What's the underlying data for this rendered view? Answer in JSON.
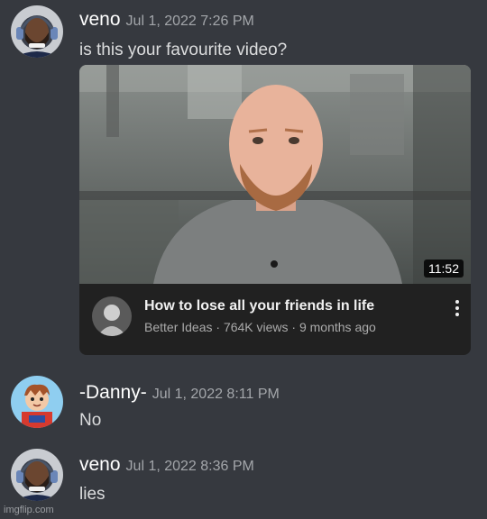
{
  "messages": [
    {
      "author": "veno",
      "timestamp": "Jul 1, 2022 7:26 PM",
      "text": "is this your favourite video?",
      "avatar_icon": "bearded-man-headphones-avatar"
    },
    {
      "author": "-Danny-",
      "timestamp": "Jul 1, 2022 8:11 PM",
      "text": "No",
      "avatar_icon": "cartoon-boy-avatar"
    },
    {
      "author": "veno",
      "timestamp": "Jul 1, 2022 8:36 PM",
      "text": "lies",
      "avatar_icon": "bearded-man-headphones-avatar"
    }
  ],
  "embed": {
    "title": "How to lose all your friends in life",
    "meta": "Better Ideas · 764K views · 9 months ago",
    "duration": "11:52",
    "thumbnail_icon": "bald-man-thumbnail",
    "channel_icon": "channel-avatar-icon",
    "menu_icon": "kebab-menu-icon"
  },
  "watermark": "imgflip.com",
  "colors": {
    "background": "#36393f",
    "author": "#ffffff",
    "timestamp": "#a3a6aa",
    "message_text": "#dcddde",
    "embed_background": "#212121",
    "embed_meta": "#aaaaaa"
  }
}
